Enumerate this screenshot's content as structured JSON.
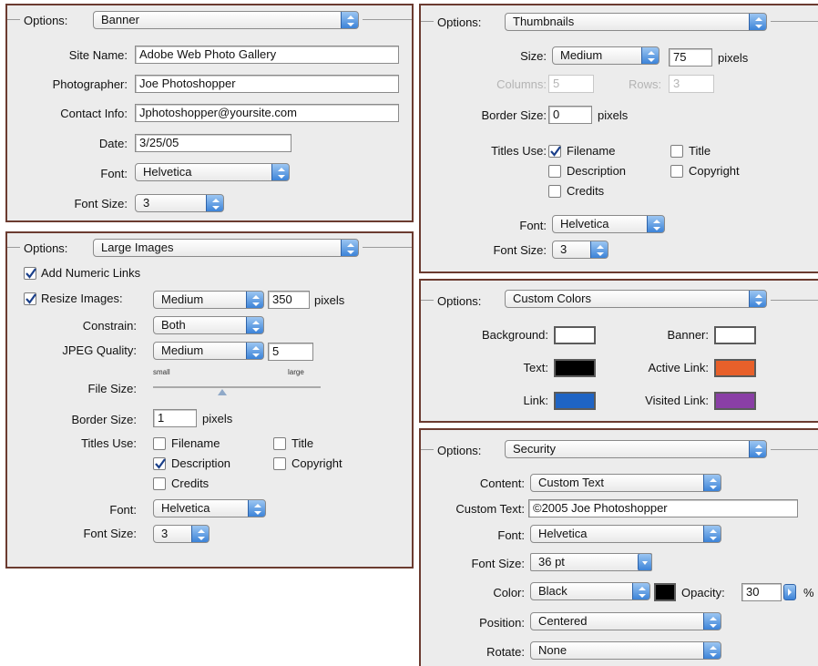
{
  "banner": {
    "options_label": "Options:",
    "options_value": "Banner",
    "site_name_label": "Site Name:",
    "site_name_value": "Adobe Web Photo Gallery",
    "photographer_label": "Photographer:",
    "photographer_value": "Joe Photoshopper",
    "contact_label": "Contact Info:",
    "contact_value": "Jphotoshopper@yoursite.com",
    "date_label": "Date:",
    "date_value": "3/25/05",
    "font_label": "Font:",
    "font_value": "Helvetica",
    "font_size_label": "Font Size:",
    "font_size_value": "3"
  },
  "large_images": {
    "options_label": "Options:",
    "options_value": "Large Images",
    "add_numeric_links_label": "Add Numeric Links",
    "add_numeric_links_checked": true,
    "resize_images_label": "Resize Images:",
    "resize_images_checked": true,
    "resize_value": "Medium",
    "resize_pixels": "350",
    "pixels_label": "pixels",
    "constrain_label": "Constrain:",
    "constrain_value": "Both",
    "jpeg_quality_label": "JPEG Quality:",
    "jpeg_quality_value": "Medium",
    "jpeg_quality_number": "5",
    "file_size_label": "File Size:",
    "file_size_small": "small",
    "file_size_large": "large",
    "border_size_label": "Border Size:",
    "border_size_value": "1",
    "border_pixels_label": "pixels",
    "titles_use_label": "Titles Use:",
    "filename_label": "Filename",
    "filename_checked": false,
    "title_label": "Title",
    "title_checked": false,
    "description_label": "Description",
    "description_checked": true,
    "copyright_label": "Copyright",
    "copyright_checked": false,
    "credits_label": "Credits",
    "credits_checked": false,
    "font_label": "Font:",
    "font_value": "Helvetica",
    "font_size_label": "Font Size:",
    "font_size_value": "3"
  },
  "thumbnails": {
    "options_label": "Options:",
    "options_value": "Thumbnails",
    "size_label": "Size:",
    "size_value": "Medium",
    "size_pixels": "75",
    "pixels_label": "pixels",
    "columns_label": "Columns:",
    "columns_value": "5",
    "rows_label": "Rows:",
    "rows_value": "3",
    "border_size_label": "Border Size:",
    "border_size_value": "0",
    "border_pixels_label": "pixels",
    "titles_use_label": "Titles Use:",
    "filename_label": "Filename",
    "filename_checked": true,
    "title_label": "Title",
    "title_checked": false,
    "description_label": "Description",
    "description_checked": false,
    "copyright_label": "Copyright",
    "copyright_checked": false,
    "credits_label": "Credits",
    "credits_checked": false,
    "font_label": "Font:",
    "font_value": "Helvetica",
    "font_size_label": "Font Size:",
    "font_size_value": "3"
  },
  "custom_colors": {
    "options_label": "Options:",
    "options_value": "Custom Colors",
    "background_label": "Background:",
    "background_color": "#ffffff",
    "banner_label": "Banner:",
    "banner_color": "#ffffff",
    "text_label": "Text:",
    "text_color": "#000000",
    "active_link_label": "Active Link:",
    "active_link_color": "#e8602a",
    "link_label": "Link:",
    "link_color": "#1f64c4",
    "visited_link_label": "Visited Link:",
    "visited_link_color": "#8a3fa6"
  },
  "security": {
    "options_label": "Options:",
    "options_value": "Security",
    "content_label": "Content:",
    "content_value": "Custom Text",
    "custom_text_label": "Custom Text:",
    "custom_text_value": "©2005 Joe Photoshopper",
    "font_label": "Font:",
    "font_value": "Helvetica",
    "font_size_label": "Font Size:",
    "font_size_value": "36 pt",
    "color_label": "Color:",
    "color_value": "Black",
    "color_swatch": "#000000",
    "opacity_label": "Opacity:",
    "opacity_value": "30",
    "opacity_unit": "%",
    "position_label": "Position:",
    "position_value": "Centered",
    "rotate_label": "Rotate:",
    "rotate_value": "None"
  },
  "colors": {
    "panel_border": "#6b3b30",
    "panel_bg": "#ececec",
    "arrow_blue": "#3c83d8"
  }
}
